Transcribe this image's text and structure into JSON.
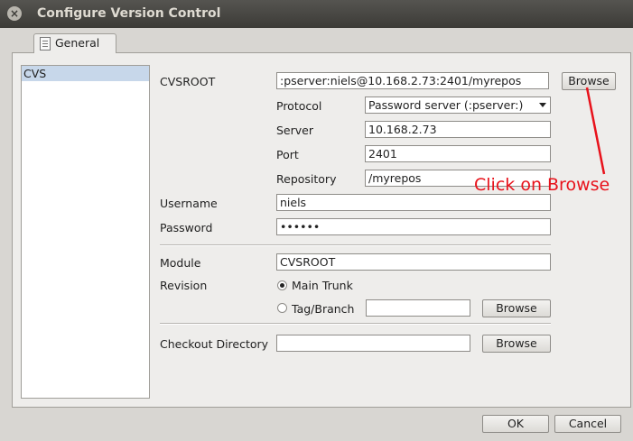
{
  "window": {
    "title": "Configure Version Control"
  },
  "tabs": [
    {
      "label": "General"
    }
  ],
  "list": {
    "items": [
      "CVS"
    ]
  },
  "form": {
    "cvsroot_label": "CVSROOT",
    "cvsroot_value": ":pserver:niels@10.168.2.73:2401/myrepos",
    "browse_label": "Browse",
    "protocol_label": "Protocol",
    "protocol_value": "Password server (:pserver:)",
    "server_label": "Server",
    "server_value": "10.168.2.73",
    "port_label": "Port",
    "port_value": "2401",
    "repository_label": "Repository",
    "repository_value": "/myrepos",
    "username_label": "Username",
    "username_value": "niels",
    "password_label": "Password",
    "password_value": "••••••",
    "module_label": "Module",
    "module_value": "CVSROOT",
    "revision_label": "Revision",
    "main_trunk_label": "Main Trunk",
    "tag_branch_label": "Tag/Branch",
    "tag_branch_value": "",
    "checkout_dir_label": "Checkout Directory",
    "checkout_dir_value": ""
  },
  "footer": {
    "ok_label": "OK",
    "cancel_label": "Cancel"
  },
  "annotation": {
    "text": "Click on Browse",
    "color": "#e8121b"
  }
}
